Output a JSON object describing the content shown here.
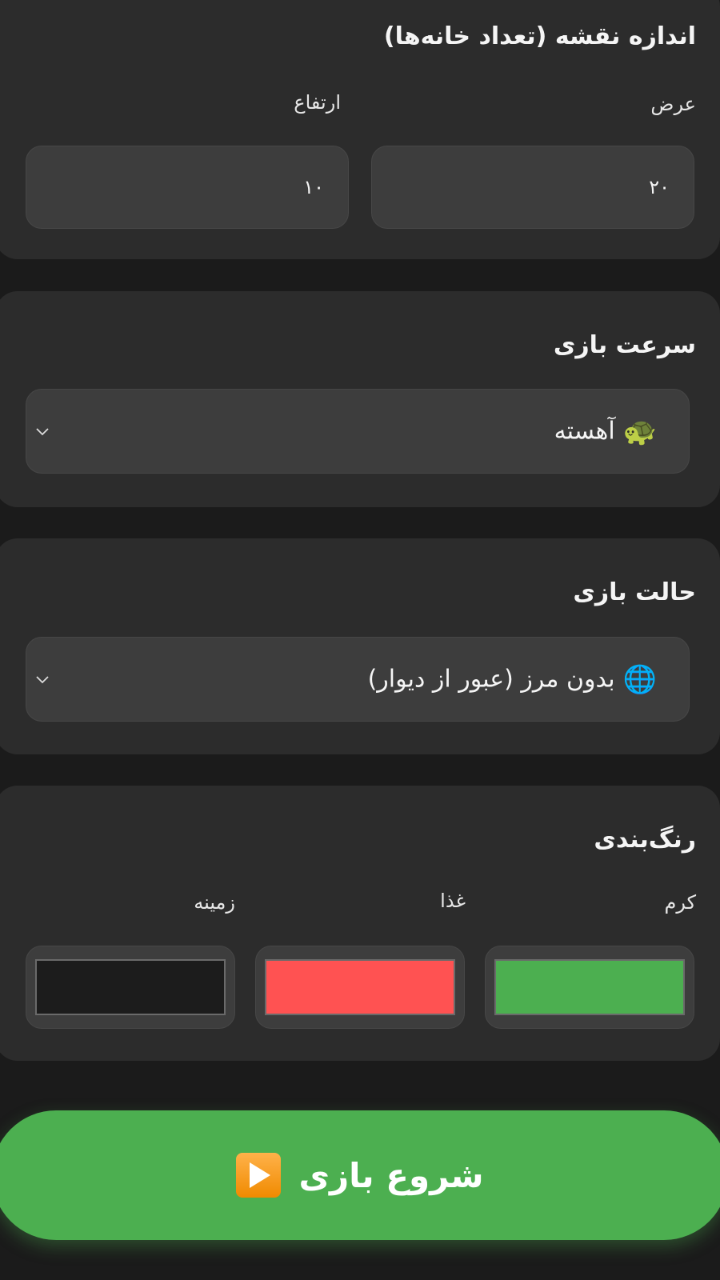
{
  "map_size": {
    "title": "اندازه نقشه (تعداد خانه‌ها)",
    "width_label": "عرض",
    "height_label": "ارتفاع",
    "width_value": "۲۰",
    "height_value": "۱۰"
  },
  "speed": {
    "title": "سرعت بازی",
    "selected_emoji": "🐢",
    "selected_label": "آهسته"
  },
  "mode": {
    "title": "حالت بازی",
    "selected_emoji": "🌐",
    "selected_label": "بدون مرز (عبور از دیوار)"
  },
  "colors": {
    "title": "رنگ‌بندی",
    "worm_label": "کرم",
    "food_label": "غذا",
    "background_label": "زمینه",
    "worm_color": "#4caf50",
    "food_color": "#ff5252",
    "background_color": "#1c1c1c"
  },
  "start_button": {
    "label": "شروع بازی",
    "icon": "play-button-icon"
  },
  "theme": {
    "accent": "#4caf50",
    "card_bg": "#2c2c2c",
    "page_bg": "#1b1b1b"
  }
}
